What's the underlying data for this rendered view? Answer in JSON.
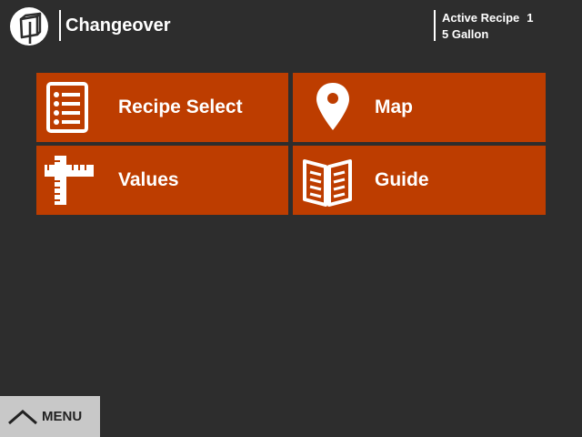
{
  "header": {
    "title": "Changeover",
    "logo_icon": "cube-logo-icon",
    "active_recipe_label": "Active Recipe",
    "active_recipe_number": "1",
    "active_recipe_name": "5 Gallon"
  },
  "tiles": [
    {
      "label": "Recipe Select",
      "icon": "list-icon"
    },
    {
      "label": "Map",
      "icon": "map-pin-icon"
    },
    {
      "label": "Values",
      "icon": "ruler-icon"
    },
    {
      "label": "Guide",
      "icon": "book-icon"
    }
  ],
  "menu": {
    "label": "MENU",
    "icon": "chevron-up-icon"
  },
  "colors": {
    "background": "#2d2d2d",
    "tile": "#bd3d00",
    "menu_button": "#c8c8c8",
    "text": "#ffffff"
  }
}
